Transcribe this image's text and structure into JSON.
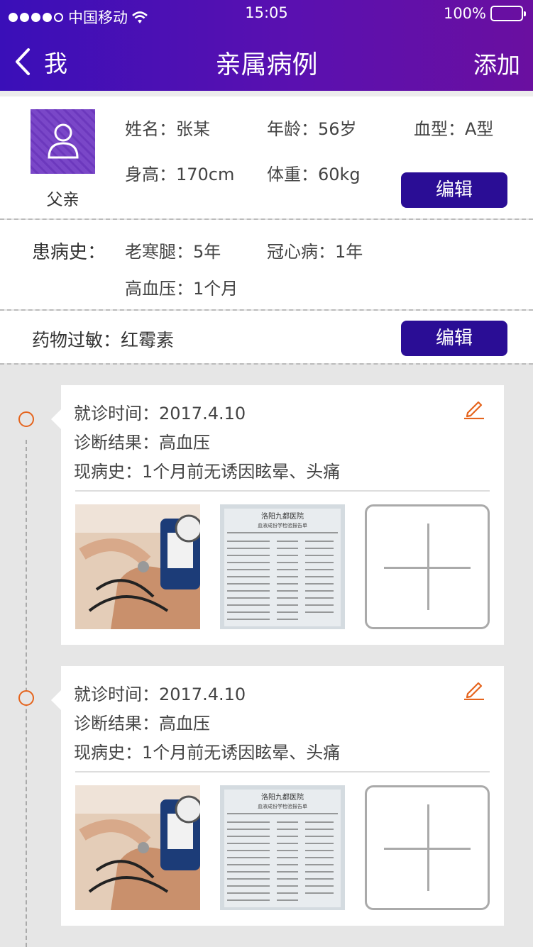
{
  "status_bar": {
    "carrier": "中国移动",
    "time": "15:05",
    "battery": "100%"
  },
  "nav": {
    "back_label": "我",
    "title": "亲属病例",
    "add_label": "添加"
  },
  "profile": {
    "relation": "父亲",
    "name": "姓名：张某",
    "age": "年龄：56岁",
    "blood_type": "血型：A型",
    "height": "身高：170cm",
    "weight": "体重：60kg",
    "edit_label": "编辑"
  },
  "history": {
    "label": "患病史：",
    "items": [
      "老寒腿：5年",
      "冠心病：1年",
      "高血压：1个月"
    ]
  },
  "allergy": {
    "text": "药物过敏：红霉素",
    "edit_label": "编辑"
  },
  "records": [
    {
      "visit_time": "就诊时间：2017.4.10",
      "diagnosis": "诊断结果：高血压",
      "present_illness": "现病史：1个月前无诱因眩晕、头痛"
    },
    {
      "visit_time": "就诊时间：2017.4.10",
      "diagnosis": "诊断结果：高血压",
      "present_illness": "现病史：1个月前无诱因眩晕、头痛"
    }
  ],
  "report_photo": {
    "hospital": "洛阳九都医院",
    "report_title": "血液成份学检验报告单"
  }
}
